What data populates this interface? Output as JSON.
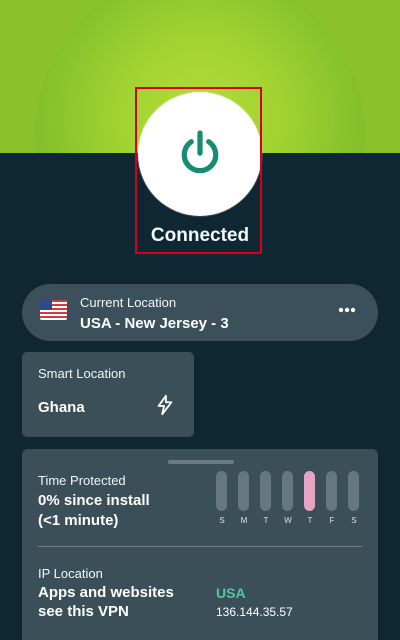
{
  "status": {
    "label": "Connected"
  },
  "current_location": {
    "label": "Current Location",
    "value": "USA - New Jersey - 3",
    "flag_icon": "us-flag-icon"
  },
  "smart_location": {
    "label": "Smart Location",
    "value": "Ghana",
    "icon": "bolt-icon"
  },
  "time_protected": {
    "label": "Time Protected",
    "line1": "0% since install",
    "line2": "(<1 minute)",
    "days": [
      {
        "label": "S",
        "active": false
      },
      {
        "label": "M",
        "active": false
      },
      {
        "label": "T",
        "active": false
      },
      {
        "label": "W",
        "active": false
      },
      {
        "label": "T",
        "active": true
      },
      {
        "label": "F",
        "active": false
      },
      {
        "label": "S",
        "active": false
      }
    ]
  },
  "ip_location": {
    "label": "IP Location",
    "line1": "Apps and websites",
    "line2": "see this VPN",
    "country": "USA",
    "address": "136.144.35.57"
  },
  "colors": {
    "background": "#0f2733",
    "accent_green": "#8bc22c",
    "power_icon": "#168c72",
    "card": "#3b4f59",
    "success_text": "#54c7a2",
    "active_day": "#e6a3c2",
    "inactive_day": "#667780",
    "highlight_border": "#d6001c"
  }
}
